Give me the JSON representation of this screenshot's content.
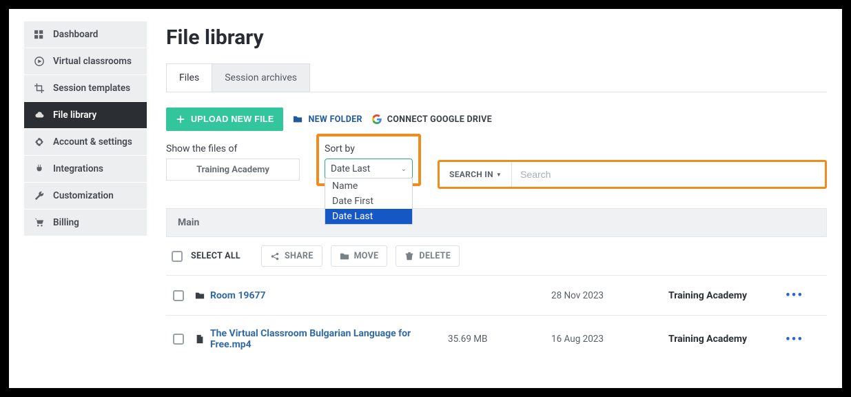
{
  "sidebar": {
    "items": [
      {
        "icon": "grid",
        "label": "Dashboard"
      },
      {
        "icon": "play",
        "label": "Virtual classrooms"
      },
      {
        "icon": "crop",
        "label": "Session templates"
      },
      {
        "icon": "cloud",
        "label": "File library",
        "active": true
      },
      {
        "icon": "gear",
        "label": "Account & settings"
      },
      {
        "icon": "plug",
        "label": "Integrations"
      },
      {
        "icon": "wrench",
        "label": "Customization"
      },
      {
        "icon": "cart",
        "label": "Billing"
      }
    ]
  },
  "page": {
    "title": "File library"
  },
  "tabs": {
    "files": "Files",
    "archives": "Session archives"
  },
  "actions": {
    "upload": "UPLOAD NEW FILE",
    "new_folder": "NEW FOLDER",
    "connect_drive": "CONNECT GOOGLE DRIVE"
  },
  "filters": {
    "show_label": "Show the files of",
    "show_value": "Training Academy",
    "sort_label": "Sort by",
    "sort_value": "Date Last",
    "sort_options": [
      "Name",
      "Date First",
      "Date Last"
    ],
    "sort_selected_index": 2
  },
  "search": {
    "scope_label": "SEARCH IN",
    "placeholder": "Search"
  },
  "breadcrumb": {
    "root": "Main"
  },
  "bulk": {
    "select_all": "SELECT ALL",
    "share": "SHARE",
    "move": "MOVE",
    "delete": "DELETE"
  },
  "rows": [
    {
      "type": "folder",
      "name": "Room 19677",
      "size": "",
      "date": "28 Nov 2023",
      "owner": "Training Academy"
    },
    {
      "type": "file",
      "name": "The Virtual Classroom Bulgarian Language for Free.mp4",
      "size": "35.69 MB",
      "date": "16 Aug 2023",
      "owner": "Training Academy"
    }
  ]
}
